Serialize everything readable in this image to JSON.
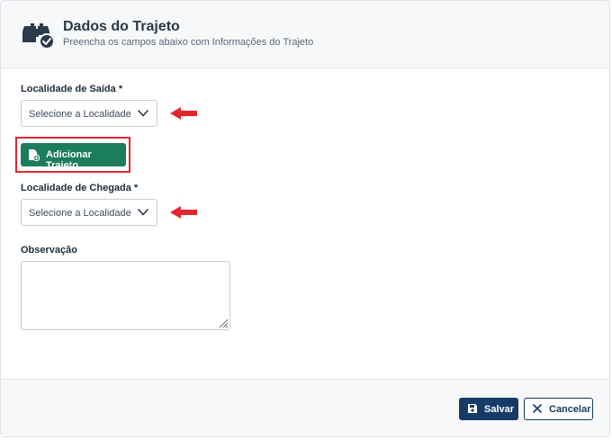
{
  "header": {
    "icon": "map-route-check-icon",
    "title": "Dados do Trajeto",
    "subtitle": "Preencha os campos abaixo com Informações do Trajeto"
  },
  "form": {
    "departure": {
      "label": "Localidade de Saída *",
      "placeholder": "Selecione a Localidade"
    },
    "add_route_button": "Adicionar Trajeto",
    "arrival": {
      "label": "Localidade de Chegada *",
      "placeholder": "Selecione a Localidade"
    },
    "observation": {
      "label": "Observação",
      "value": ""
    }
  },
  "footer": {
    "save_label": "Salvar",
    "cancel_label": "Cancelar"
  },
  "colors": {
    "primary": "#163b66",
    "add_button": "#1b7d5c",
    "annotation_red": "#e3262e"
  }
}
